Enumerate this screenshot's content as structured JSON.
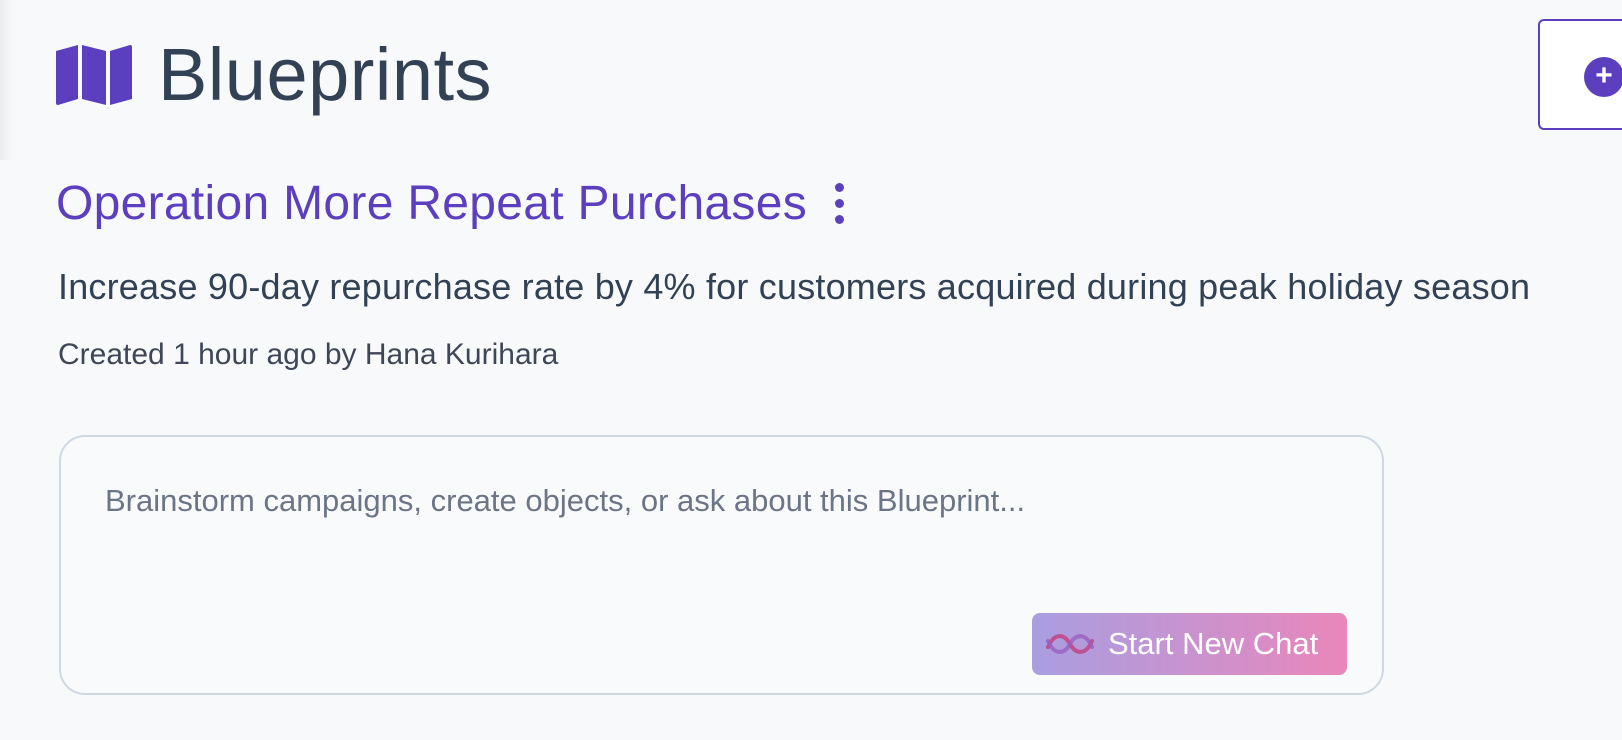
{
  "header": {
    "title": "Blueprints",
    "icon": "map-icon",
    "new_button_icon": "plus-circle-icon"
  },
  "blueprint": {
    "title": "Operation More Repeat Purchases",
    "goal": "Increase 90-day repurchase rate by 4% for customers acquired during peak holiday season",
    "meta": "Created 1 hour ago by Hana Kurihara"
  },
  "chat": {
    "placeholder": "Brainstorm campaigns, create objects, or ask about this Blueprint...",
    "value": "",
    "start_button_label": "Start New Chat",
    "start_button_icon": "wave-icon"
  },
  "colors": {
    "accent": "#5b3fbf",
    "text": "#334155",
    "gradient_start": "#a99ee0",
    "gradient_end": "#ea86b9"
  }
}
